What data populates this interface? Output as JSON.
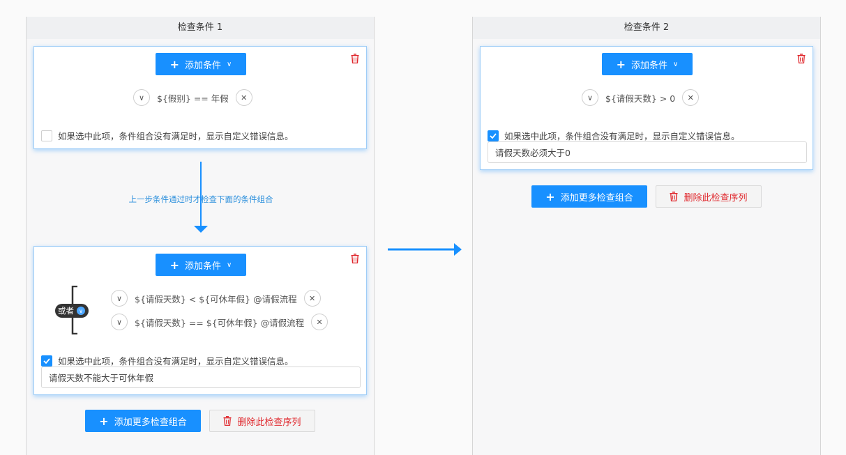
{
  "columns": [
    {
      "title": "检查条件 1",
      "groups": [
        {
          "add_condition_label": "添加条件",
          "conditions": [
            "${假别} == 年假"
          ],
          "checkbox_checked": false,
          "checkbox_label": "如果选中此项，条件组合没有满足时，显示自定义错误信息。"
        },
        {
          "add_condition_label": "添加条件",
          "operator_label": "或者",
          "conditions": [
            "${请假天数} < ${可休年假} @请假流程",
            "${请假天数} == ${可休年假} @请假流程"
          ],
          "checkbox_checked": true,
          "checkbox_label": "如果选中此项，条件组合没有满足时，显示自定义错误信息。",
          "error_message": "请假天数不能大于可休年假"
        }
      ],
      "connector_label": "上一步条件通过时才检查下面的条件组合",
      "add_group_label": "添加更多检查组合",
      "delete_sequence_label": "删除此检查序列"
    },
    {
      "title": "检查条件 2",
      "groups": [
        {
          "add_condition_label": "添加条件",
          "conditions": [
            "${请假天数} > 0"
          ],
          "checkbox_checked": true,
          "checkbox_label": "如果选中此项，条件组合没有满足时，显示自定义错误信息。",
          "error_message": "请假天数必须大于0"
        }
      ],
      "add_group_label": "添加更多检查组合",
      "delete_sequence_label": "删除此检查序列"
    }
  ],
  "colors": {
    "primary": "#1890ff",
    "danger": "#e0282d",
    "connector_text": "#2b8fdc"
  }
}
